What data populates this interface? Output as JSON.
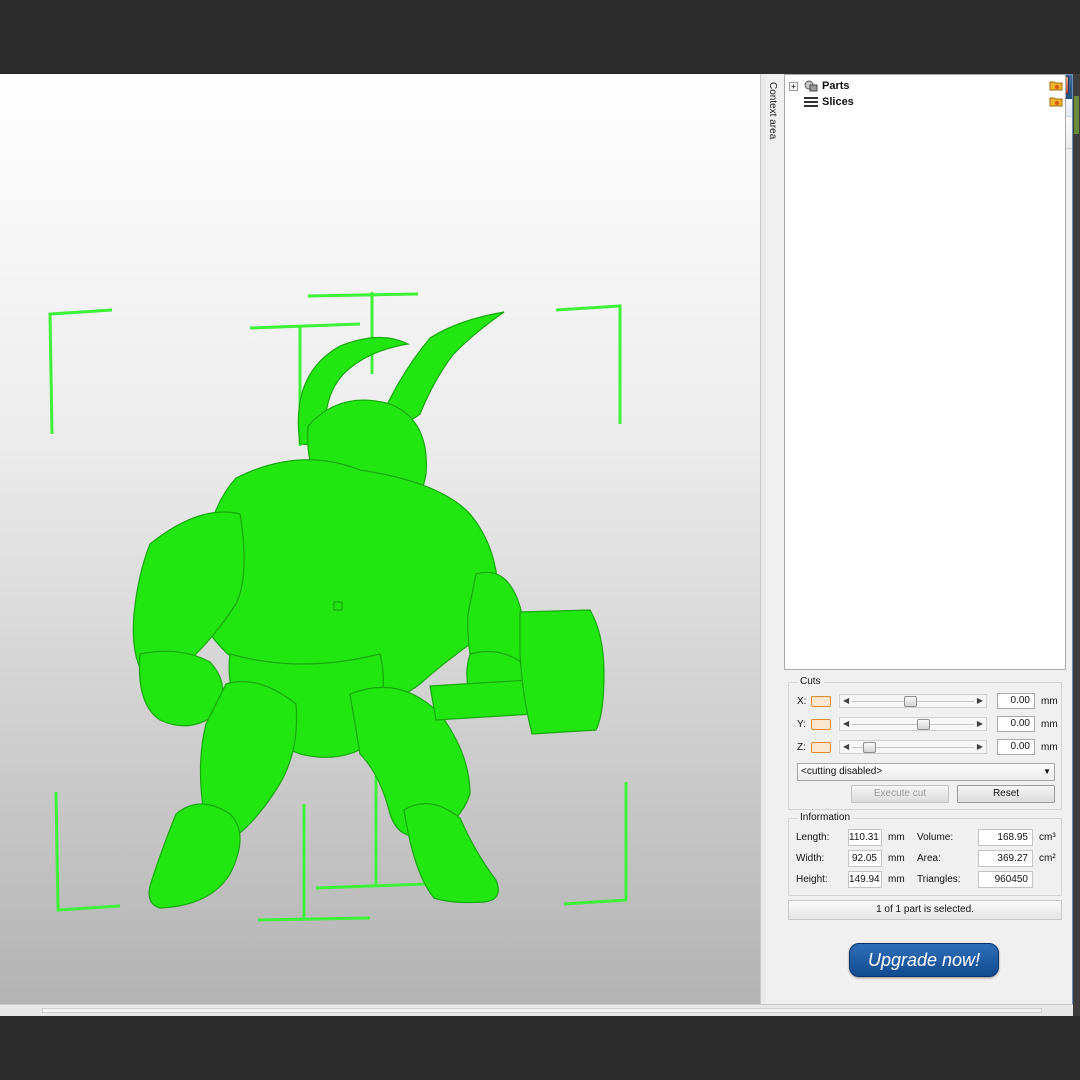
{
  "window": {
    "title_text": "",
    "controls": {
      "minimize": "─",
      "maximize": "☐",
      "close": "✕"
    }
  },
  "toolbar": {
    "icons": [
      "view-icon",
      "color-spheres-icon",
      "pie-icon",
      "transform-icon",
      "add-icon",
      "mirror-icon",
      "ruler-icon",
      "check-icon"
    ]
  },
  "context_area": {
    "label": "Context area"
  },
  "tree": {
    "items": [
      {
        "label": "Parts",
        "expander": "+"
      },
      {
        "label": "Slices",
        "expander": ""
      }
    ]
  },
  "cuts": {
    "title": "Cuts",
    "rows": [
      {
        "axis": "X:",
        "value": "0.00",
        "unit": "mm",
        "slider_position": 0.48
      },
      {
        "axis": "Y:",
        "value": "0.00",
        "unit": "mm",
        "slider_position": 0.6
      },
      {
        "axis": "Z:",
        "value": "0.00",
        "unit": "mm",
        "slider_position": 0.1
      }
    ],
    "mode": "<cutting disabled>",
    "execute_label": "Execute cut",
    "reset_label": "Reset"
  },
  "information": {
    "title": "Information",
    "length_label": "Length:",
    "length_value": "110.31",
    "length_unit": "mm",
    "width_label": "Width:",
    "width_value": "92.05",
    "width_unit": "mm",
    "height_label": "Height:",
    "height_value": "149.94",
    "height_unit": "mm",
    "volume_label": "Volume:",
    "volume_value": "168.95",
    "volume_unit": "cm³",
    "area_label": "Area:",
    "area_value": "369.27",
    "area_unit": "cm²",
    "triangles_label": "Triangles:",
    "triangles_value": "960450"
  },
  "status": {
    "selection_text": "1 of 1 part is selected."
  },
  "upgrade": {
    "label": "Upgrade now!"
  },
  "colors": {
    "model": "#22e610",
    "bbox": "#3ef23a",
    "upgrade": "#1b5aa3",
    "cut_swatch": "#e08a2c"
  }
}
